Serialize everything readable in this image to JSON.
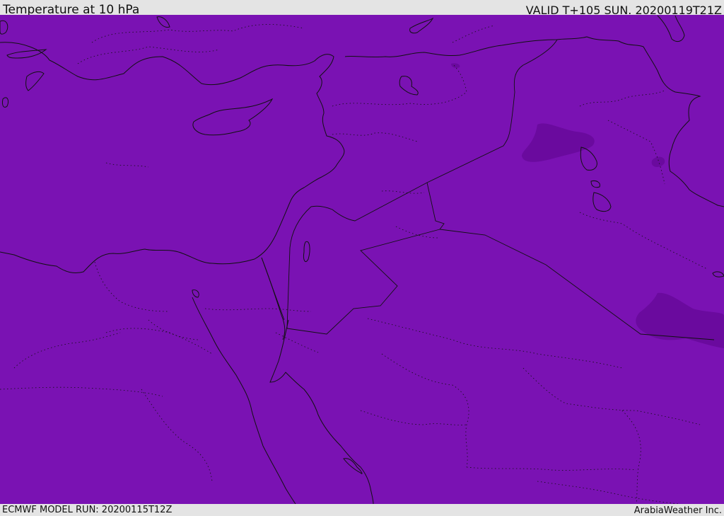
{
  "header": {
    "title": "Temperature at 10 hPa",
    "valid_time": "VALID T+105 SUN. 20200119T21Z"
  },
  "footer": {
    "model_run": "ECMWF MODEL RUN: 20200115T12Z",
    "credit": "ArabiaWeather Inc."
  },
  "map": {
    "fill_color": "#7a12b3",
    "cold_patch_color": "#6a0a9e",
    "coastline_color": "#111111",
    "border_color": "#111111"
  }
}
